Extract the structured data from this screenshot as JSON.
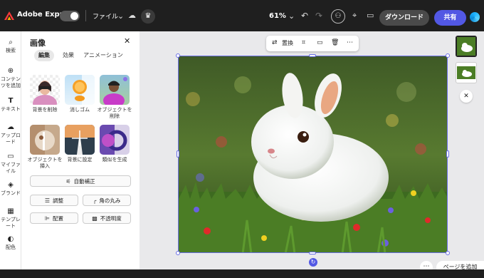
{
  "app": {
    "title": "Adobe Express"
  },
  "topbar": {
    "file_menu": "ファイル",
    "zoom": "61%",
    "download_label": "ダウンロード",
    "share_label": "共有"
  },
  "rail": {
    "items": [
      {
        "icon": "search-icon",
        "label": "検索"
      },
      {
        "icon": "add-content-icon",
        "label": "コンテンツを追加"
      },
      {
        "icon": "text-icon",
        "label": "テキスト"
      },
      {
        "icon": "upload-icon",
        "label": "アップロード"
      },
      {
        "icon": "folder-icon",
        "label": "マイファイル"
      },
      {
        "icon": "brand-icon",
        "label": "ブランド"
      },
      {
        "icon": "template-icon",
        "label": "テンプレート"
      },
      {
        "icon": "palette-icon",
        "label": "配色"
      }
    ]
  },
  "panel": {
    "title": "画像",
    "tabs": [
      "編集",
      "効果",
      "アニメーション"
    ],
    "active_tab": "編集",
    "tools": [
      {
        "label": "背景を削除"
      },
      {
        "label": "消しゴム"
      },
      {
        "label": "オブジェクトを削除"
      },
      {
        "label": "オブジェクトを挿入"
      },
      {
        "label": "背景に設定"
      },
      {
        "label": "類似を生成"
      }
    ],
    "auto_enhance": "自動補正",
    "buttons": {
      "adjust": "調整",
      "round_corners": "角の丸み",
      "align": "配置",
      "opacity": "不透明度"
    }
  },
  "canvas": {
    "toolbar": {
      "replace_label": "置換"
    },
    "add_page_label": "ページを追加"
  },
  "colors": {
    "accent": "#5258e4",
    "topbar_bg": "#1f1f1f",
    "selection": "#6b6fe6"
  }
}
